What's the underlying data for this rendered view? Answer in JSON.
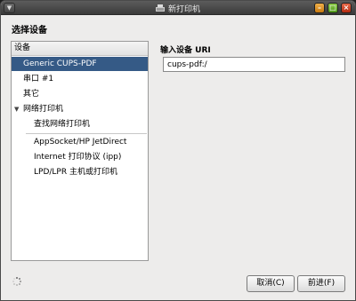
{
  "window": {
    "title": "新打印机",
    "menu_glyph": "▼",
    "minimize_glyph": "–",
    "maximize_glyph": "□",
    "close_glyph": "×"
  },
  "page": {
    "heading": "选择设备"
  },
  "device_list": {
    "header": "设备",
    "items": [
      {
        "label": "Generic CUPS-PDF",
        "selected": true
      },
      {
        "label": "串口 #1"
      },
      {
        "label": "其它"
      },
      {
        "label": "网络打印机",
        "expander": "▼",
        "expanded": true
      },
      {
        "label": "查找网络打印机"
      },
      {
        "label": "AppSocket/HP JetDirect"
      },
      {
        "label": "Internet 打印协议 (ipp)"
      },
      {
        "label": "LPD/LPR 主机或打印机"
      }
    ]
  },
  "uri": {
    "label": "输入设备 URI",
    "value": "cups-pdf:/"
  },
  "buttons": {
    "cancel": "取消(C)",
    "forward": "前进(F)"
  },
  "colors": {
    "selection": "#355a86",
    "dialog_bg": "#edeceb"
  }
}
